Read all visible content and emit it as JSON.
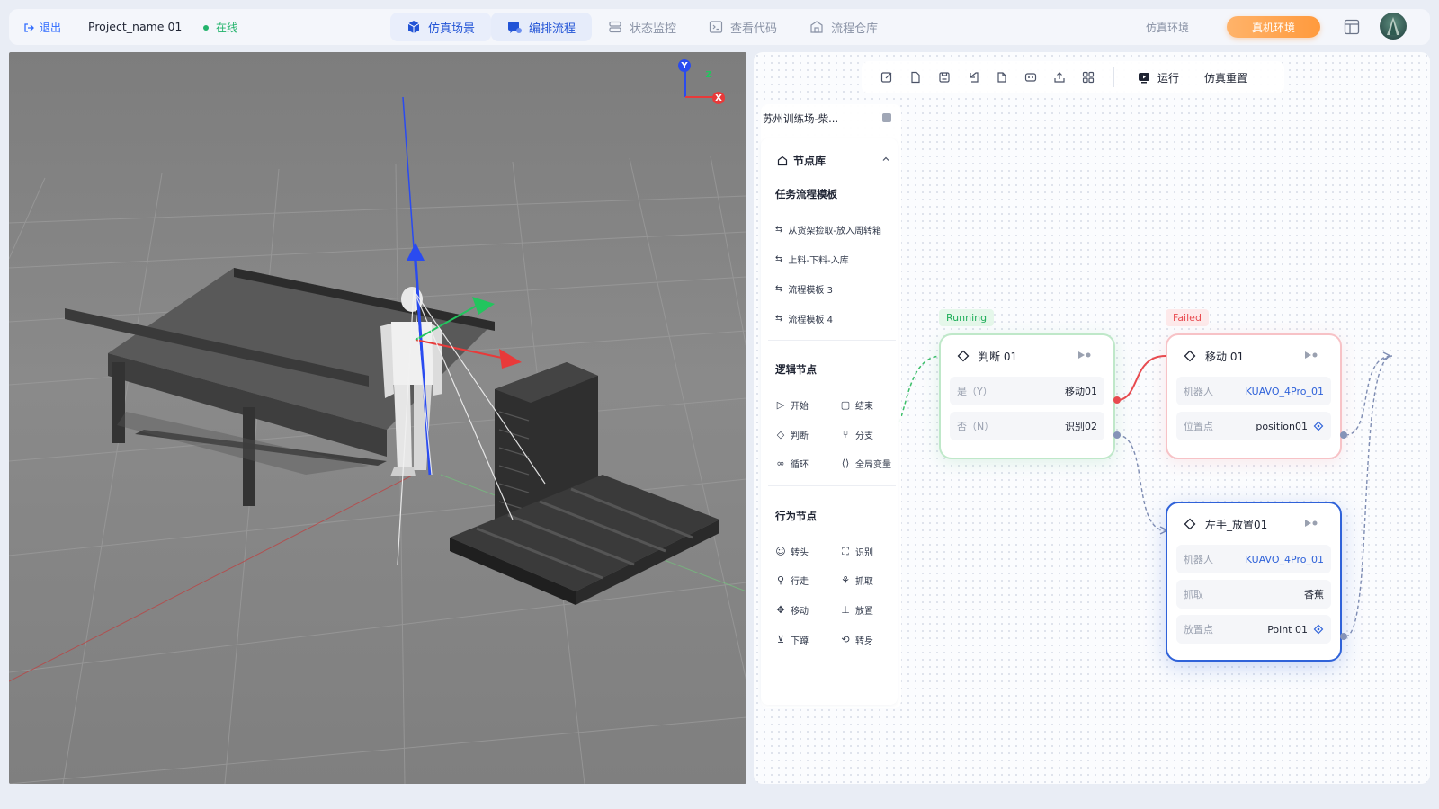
{
  "topbar": {
    "exit_label": "退出",
    "project_name": "Project_name 01",
    "status_label": "在线",
    "tabs": [
      {
        "label": "仿真场景",
        "icon": "cube-icon",
        "state": "active"
      },
      {
        "label": "编排流程",
        "icon": "flow-icon",
        "state": "active"
      },
      {
        "label": "状态监控",
        "icon": "monitor-icon",
        "state": "inactive"
      },
      {
        "label": "查看代码",
        "icon": "code-icon",
        "state": "inactive"
      },
      {
        "label": "流程仓库",
        "icon": "warehouse-icon",
        "state": "inactive"
      }
    ],
    "env_sim_label": "仿真环境",
    "env_real_label": "真机环境"
  },
  "viewport": {
    "gizmo": {
      "y_label": "Y",
      "z_label": "Z",
      "x_label": "X"
    },
    "colors": {
      "x_axis": "#e83a3a",
      "y_axis": "#2a4bf0",
      "z_axis": "#22c55e"
    }
  },
  "editor": {
    "toolbar": {
      "icons": [
        "edit-icon",
        "new-file-icon",
        "save-icon",
        "undo-icon",
        "redo-icon",
        "preview-icon",
        "export-icon",
        "grid-icon"
      ],
      "run_label": "运行",
      "reset_label": "仿真重置"
    },
    "scene_name": "苏州训练场-柴...",
    "node_library": {
      "title": "节点库",
      "template_section": "任务流程模板",
      "templates": [
        "从货架捡取-放入周转箱",
        "上料-下料-入库",
        "流程模板 3",
        "流程模板 4"
      ],
      "logic_section": "逻辑节点",
      "logic_nodes": [
        {
          "label": "开始",
          "icon": "play-icon"
        },
        {
          "label": "结束",
          "icon": "stop-icon"
        },
        {
          "label": "判断",
          "icon": "diamond-icon"
        },
        {
          "label": "分支",
          "icon": "branch-icon"
        },
        {
          "label": "循环",
          "icon": "loop-icon"
        },
        {
          "label": "全局变量",
          "icon": "variable-icon"
        }
      ],
      "behavior_section": "行为节点",
      "behavior_nodes": [
        {
          "label": "转头",
          "icon": "head-turn-icon"
        },
        {
          "label": "识别",
          "icon": "scan-icon"
        },
        {
          "label": "行走",
          "icon": "walk-icon"
        },
        {
          "label": "抓取",
          "icon": "grab-icon"
        },
        {
          "label": "移动",
          "icon": "move-icon"
        },
        {
          "label": "放置",
          "icon": "place-icon"
        },
        {
          "label": "下蹲",
          "icon": "squat-icon"
        },
        {
          "label": "转身",
          "icon": "turn-body-icon"
        }
      ]
    },
    "nodes": {
      "judge": {
        "status": "Running",
        "title": "判断 01",
        "rows": [
          {
            "key": "是（Y）",
            "value": "移动01"
          },
          {
            "key": "否（N）",
            "value": "识别02"
          }
        ]
      },
      "move": {
        "status": "Failed",
        "title": "移动 01",
        "rows": [
          {
            "key": "机器人",
            "value": "KUAVO_4Pro_01"
          },
          {
            "key": "位置点",
            "value": "position01"
          }
        ]
      },
      "place": {
        "title": "左手_放置01",
        "rows": [
          {
            "key": "机器人",
            "value": "KUAVO_4Pro_01"
          },
          {
            "key": "抓取",
            "value": "香蕉"
          },
          {
            "key": "放置点",
            "value": "Point 01"
          }
        ]
      }
    },
    "colors": {
      "running": "#1fae5a",
      "failed": "#e84a4f",
      "selected": "#2f62d9"
    }
  }
}
